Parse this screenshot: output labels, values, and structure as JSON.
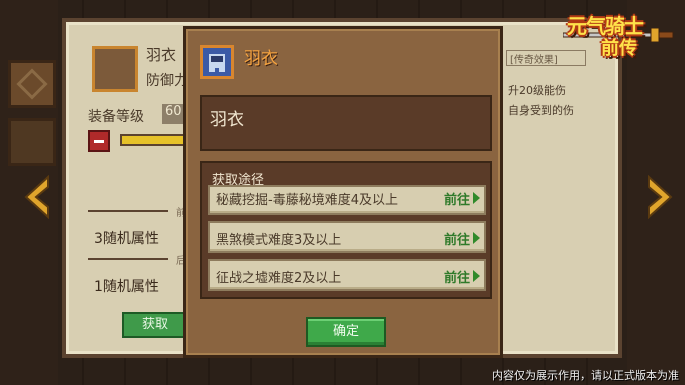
{
  "logo": {
    "line1": "元气骑士",
    "line2": "前传"
  },
  "background_panel": {
    "item_name": "羽衣",
    "defense_label": "防御力",
    "level_label": "装备等级",
    "level_value": "60",
    "level_progress": 0.5,
    "random_attr_1": "3随机属性",
    "random_attr_2": "1随机属性",
    "section_1_small": "前缀",
    "section_2_small": "后缀",
    "get_button": "获取",
    "right_frame_label": "[传奇效果]",
    "right_text_1": "升20级能伤",
    "right_text_2": "自身受到的伤"
  },
  "modal": {
    "title": "羽衣",
    "item_name": "羽衣",
    "sources_header": "获取途径",
    "sources": [
      {
        "text": "秘藏挖掘-毒藤秘境难度4及以上",
        "action": "前往"
      },
      {
        "text": "黑煞模式难度3及以上",
        "action": "前往"
      },
      {
        "text": "征战之墟难度2及以上",
        "action": "前往"
      }
    ],
    "confirm_label": "确定"
  },
  "disclaimer": "内容仅为展示作用，请以正式版本为准",
  "colors": {
    "accent_title": "#f6a440",
    "confirm_green": "#3fa94a",
    "go_green": "#2f7a2a"
  },
  "icons": [
    "sword-icon",
    "left-arrow-icon",
    "right-arrow-icon",
    "armor-icon",
    "minus-icon",
    "go-arrow-icon"
  ]
}
